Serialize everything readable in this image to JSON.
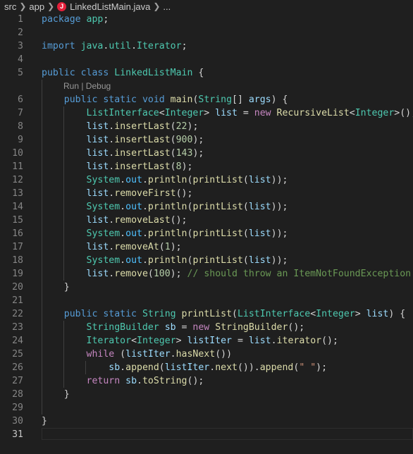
{
  "breadcrumb": {
    "items": [
      "src",
      "app",
      "LinkedListMain.java",
      "..."
    ],
    "file_icon_glyph": "J",
    "file_icon_color": "#e51f3a"
  },
  "codelens": {
    "text": "Run | Debug",
    "after_line": 5
  },
  "editor": {
    "active_line": 31,
    "lines": [
      {
        "n": "1",
        "tokens": [
          [
            "kw",
            "package"
          ],
          [
            "pun",
            " "
          ],
          [
            "pkg",
            "app"
          ],
          [
            "pun",
            ";"
          ]
        ]
      },
      {
        "n": "2",
        "tokens": []
      },
      {
        "n": "3",
        "tokens": [
          [
            "kw",
            "import"
          ],
          [
            "pun",
            " "
          ],
          [
            "pkg",
            "java"
          ],
          [
            "pun",
            "."
          ],
          [
            "pkg",
            "util"
          ],
          [
            "pun",
            "."
          ],
          [
            "typ",
            "Iterator"
          ],
          [
            "pun",
            ";"
          ]
        ]
      },
      {
        "n": "4",
        "tokens": []
      },
      {
        "n": "5",
        "tokens": [
          [
            "kw",
            "public"
          ],
          [
            "pun",
            " "
          ],
          [
            "kw",
            "class"
          ],
          [
            "pun",
            " "
          ],
          [
            "typ",
            "LinkedListMain"
          ],
          [
            "pun",
            " {"
          ]
        ]
      },
      {
        "n": "6",
        "tokens": [
          [
            "pun",
            "    "
          ],
          [
            "kw",
            "public"
          ],
          [
            "pun",
            " "
          ],
          [
            "kw",
            "static"
          ],
          [
            "pun",
            " "
          ],
          [
            "kw",
            "void"
          ],
          [
            "pun",
            " "
          ],
          [
            "fn",
            "main"
          ],
          [
            "pun",
            "("
          ],
          [
            "typ",
            "String"
          ],
          [
            "pun",
            "[] "
          ],
          [
            "var",
            "args"
          ],
          [
            "pun",
            ") {"
          ]
        ]
      },
      {
        "n": "7",
        "tokens": [
          [
            "pun",
            "        "
          ],
          [
            "typ",
            "ListInterface"
          ],
          [
            "pun",
            "<"
          ],
          [
            "typ",
            "Integer"
          ],
          [
            "pun",
            "> "
          ],
          [
            "var",
            "list"
          ],
          [
            "pun",
            " = "
          ],
          [
            "ctl",
            "new"
          ],
          [
            "pun",
            " "
          ],
          [
            "fn",
            "RecursiveList"
          ],
          [
            "pun",
            "<"
          ],
          [
            "typ",
            "Integer"
          ],
          [
            "pun",
            ">();"
          ]
        ]
      },
      {
        "n": "8",
        "tokens": [
          [
            "pun",
            "        "
          ],
          [
            "var",
            "list"
          ],
          [
            "pun",
            "."
          ],
          [
            "fn",
            "insertLast"
          ],
          [
            "pun",
            "("
          ],
          [
            "num",
            "22"
          ],
          [
            "pun",
            ");"
          ]
        ]
      },
      {
        "n": "9",
        "tokens": [
          [
            "pun",
            "        "
          ],
          [
            "var",
            "list"
          ],
          [
            "pun",
            "."
          ],
          [
            "fn",
            "insertLast"
          ],
          [
            "pun",
            "("
          ],
          [
            "num",
            "900"
          ],
          [
            "pun",
            ");"
          ]
        ]
      },
      {
        "n": "10",
        "tokens": [
          [
            "pun",
            "        "
          ],
          [
            "var",
            "list"
          ],
          [
            "pun",
            "."
          ],
          [
            "fn",
            "insertLast"
          ],
          [
            "pun",
            "("
          ],
          [
            "num",
            "143"
          ],
          [
            "pun",
            ");"
          ]
        ]
      },
      {
        "n": "11",
        "tokens": [
          [
            "pun",
            "        "
          ],
          [
            "var",
            "list"
          ],
          [
            "pun",
            "."
          ],
          [
            "fn",
            "insertLast"
          ],
          [
            "pun",
            "("
          ],
          [
            "num",
            "8"
          ],
          [
            "pun",
            ");"
          ]
        ]
      },
      {
        "n": "12",
        "tokens": [
          [
            "pun",
            "        "
          ],
          [
            "typ",
            "System"
          ],
          [
            "pun",
            "."
          ],
          [
            "fld",
            "out"
          ],
          [
            "pun",
            "."
          ],
          [
            "fn",
            "println"
          ],
          [
            "pun",
            "("
          ],
          [
            "fn",
            "printList"
          ],
          [
            "pun",
            "("
          ],
          [
            "var",
            "list"
          ],
          [
            "pun",
            "));"
          ]
        ]
      },
      {
        "n": "13",
        "tokens": [
          [
            "pun",
            "        "
          ],
          [
            "var",
            "list"
          ],
          [
            "pun",
            "."
          ],
          [
            "fn",
            "removeFirst"
          ],
          [
            "pun",
            "();"
          ]
        ]
      },
      {
        "n": "14",
        "tokens": [
          [
            "pun",
            "        "
          ],
          [
            "typ",
            "System"
          ],
          [
            "pun",
            "."
          ],
          [
            "fld",
            "out"
          ],
          [
            "pun",
            "."
          ],
          [
            "fn",
            "println"
          ],
          [
            "pun",
            "("
          ],
          [
            "fn",
            "printList"
          ],
          [
            "pun",
            "("
          ],
          [
            "var",
            "list"
          ],
          [
            "pun",
            "));"
          ]
        ]
      },
      {
        "n": "15",
        "tokens": [
          [
            "pun",
            "        "
          ],
          [
            "var",
            "list"
          ],
          [
            "pun",
            "."
          ],
          [
            "fn",
            "removeLast"
          ],
          [
            "pun",
            "();"
          ]
        ]
      },
      {
        "n": "16",
        "tokens": [
          [
            "pun",
            "        "
          ],
          [
            "typ",
            "System"
          ],
          [
            "pun",
            "."
          ],
          [
            "fld",
            "out"
          ],
          [
            "pun",
            "."
          ],
          [
            "fn",
            "println"
          ],
          [
            "pun",
            "("
          ],
          [
            "fn",
            "printList"
          ],
          [
            "pun",
            "("
          ],
          [
            "var",
            "list"
          ],
          [
            "pun",
            "));"
          ]
        ]
      },
      {
        "n": "17",
        "tokens": [
          [
            "pun",
            "        "
          ],
          [
            "var",
            "list"
          ],
          [
            "pun",
            "."
          ],
          [
            "fn",
            "removeAt"
          ],
          [
            "pun",
            "("
          ],
          [
            "num",
            "1"
          ],
          [
            "pun",
            ");"
          ]
        ]
      },
      {
        "n": "18",
        "tokens": [
          [
            "pun",
            "        "
          ],
          [
            "typ",
            "System"
          ],
          [
            "pun",
            "."
          ],
          [
            "fld",
            "out"
          ],
          [
            "pun",
            "."
          ],
          [
            "fn",
            "println"
          ],
          [
            "pun",
            "("
          ],
          [
            "fn",
            "printList"
          ],
          [
            "pun",
            "("
          ],
          [
            "var",
            "list"
          ],
          [
            "pun",
            "));"
          ]
        ]
      },
      {
        "n": "19",
        "tokens": [
          [
            "pun",
            "        "
          ],
          [
            "var",
            "list"
          ],
          [
            "pun",
            "."
          ],
          [
            "fn",
            "remove"
          ],
          [
            "pun",
            "("
          ],
          [
            "num",
            "100"
          ],
          [
            "pun",
            "); "
          ],
          [
            "com",
            "// should throw an ItemNotFoundException"
          ]
        ]
      },
      {
        "n": "20",
        "tokens": [
          [
            "pun",
            "    }"
          ]
        ]
      },
      {
        "n": "21",
        "tokens": []
      },
      {
        "n": "22",
        "tokens": [
          [
            "pun",
            "    "
          ],
          [
            "kw",
            "public"
          ],
          [
            "pun",
            " "
          ],
          [
            "kw",
            "static"
          ],
          [
            "pun",
            " "
          ],
          [
            "typ",
            "String"
          ],
          [
            "pun",
            " "
          ],
          [
            "fn",
            "printList"
          ],
          [
            "pun",
            "("
          ],
          [
            "typ",
            "ListInterface"
          ],
          [
            "pun",
            "<"
          ],
          [
            "typ",
            "Integer"
          ],
          [
            "pun",
            "> "
          ],
          [
            "var",
            "list"
          ],
          [
            "pun",
            ") {"
          ]
        ]
      },
      {
        "n": "23",
        "tokens": [
          [
            "pun",
            "        "
          ],
          [
            "typ",
            "StringBuilder"
          ],
          [
            "pun",
            " "
          ],
          [
            "var",
            "sb"
          ],
          [
            "pun",
            " = "
          ],
          [
            "ctl",
            "new"
          ],
          [
            "pun",
            " "
          ],
          [
            "fn",
            "StringBuilder"
          ],
          [
            "pun",
            "();"
          ]
        ]
      },
      {
        "n": "24",
        "tokens": [
          [
            "pun",
            "        "
          ],
          [
            "typ",
            "Iterator"
          ],
          [
            "pun",
            "<"
          ],
          [
            "typ",
            "Integer"
          ],
          [
            "pun",
            "> "
          ],
          [
            "var",
            "listIter"
          ],
          [
            "pun",
            " = "
          ],
          [
            "var",
            "list"
          ],
          [
            "pun",
            "."
          ],
          [
            "fn",
            "iterator"
          ],
          [
            "pun",
            "();"
          ]
        ]
      },
      {
        "n": "25",
        "tokens": [
          [
            "pun",
            "        "
          ],
          [
            "ctl",
            "while"
          ],
          [
            "pun",
            " ("
          ],
          [
            "var",
            "listIter"
          ],
          [
            "pun",
            "."
          ],
          [
            "fn",
            "hasNext"
          ],
          [
            "pun",
            "())"
          ]
        ]
      },
      {
        "n": "26",
        "tokens": [
          [
            "pun",
            "            "
          ],
          [
            "var",
            "sb"
          ],
          [
            "pun",
            "."
          ],
          [
            "fn",
            "append"
          ],
          [
            "pun",
            "("
          ],
          [
            "var",
            "listIter"
          ],
          [
            "pun",
            "."
          ],
          [
            "fn",
            "next"
          ],
          [
            "pun",
            "())."
          ],
          [
            "fn",
            "append"
          ],
          [
            "pun",
            "("
          ],
          [
            "str",
            "\" \""
          ],
          [
            "pun",
            ");"
          ]
        ]
      },
      {
        "n": "27",
        "tokens": [
          [
            "pun",
            "        "
          ],
          [
            "ctl",
            "return"
          ],
          [
            "pun",
            " "
          ],
          [
            "var",
            "sb"
          ],
          [
            "pun",
            "."
          ],
          [
            "fn",
            "toString"
          ],
          [
            "pun",
            "();"
          ]
        ]
      },
      {
        "n": "28",
        "tokens": [
          [
            "pun",
            "    }"
          ]
        ]
      },
      {
        "n": "29",
        "tokens": []
      },
      {
        "n": "30",
        "tokens": [
          [
            "pun",
            "}"
          ]
        ]
      },
      {
        "n": "31",
        "tokens": []
      }
    ]
  }
}
